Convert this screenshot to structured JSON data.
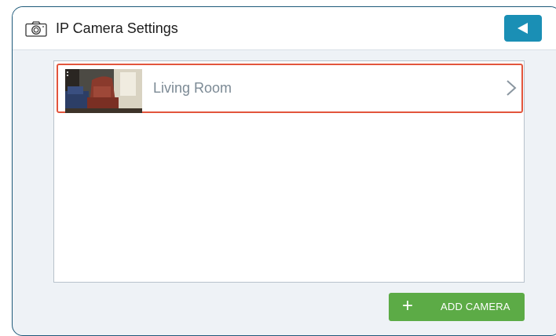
{
  "header": {
    "title": "IP Camera Settings",
    "icon": "camera-icon",
    "back_icon": "back-triangle-icon"
  },
  "cameras": [
    {
      "label": "Living Room",
      "thumbnail": "living-room-camera-thumbnail"
    }
  ],
  "actions": {
    "add_label": "ADD CAMERA",
    "add_icon": "plus-icon"
  },
  "colors": {
    "accent": "#1a8fb5",
    "selected_outline": "#e2553c",
    "add_button": "#5cab46",
    "background": "#eef2f6",
    "frame_border": "#1f5a7a"
  }
}
